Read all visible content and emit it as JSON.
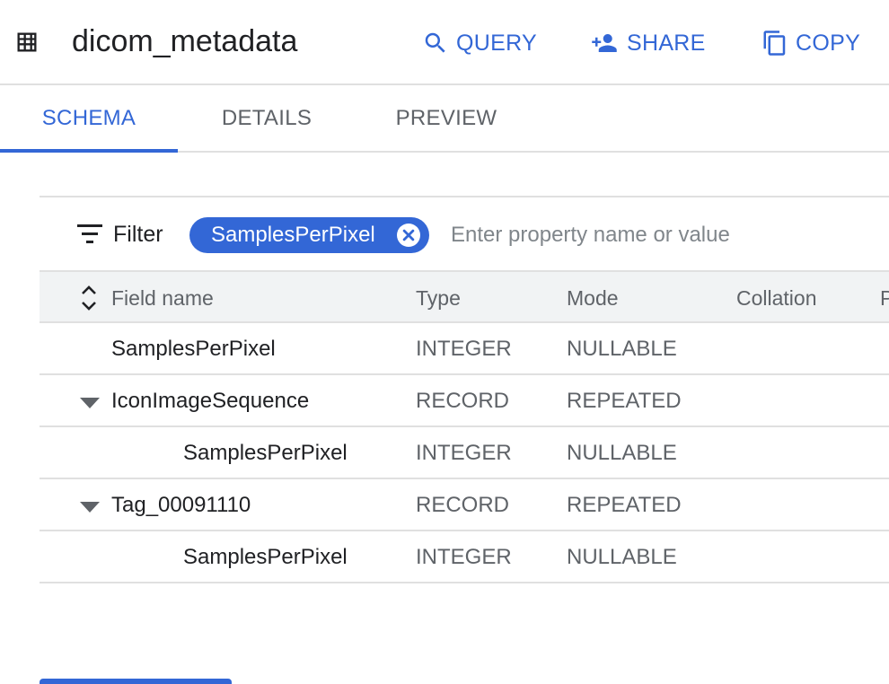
{
  "header": {
    "title": "dicom_metadata",
    "icon": "table-icon",
    "actions": [
      {
        "label": "QUERY",
        "icon": "search-icon"
      },
      {
        "label": "SHARE",
        "icon": "person-add-icon"
      },
      {
        "label": "COPY",
        "icon": "copy-icon"
      }
    ]
  },
  "tabs": [
    {
      "label": "SCHEMA",
      "active": true
    },
    {
      "label": "DETAILS",
      "active": false
    },
    {
      "label": "PREVIEW",
      "active": false
    }
  ],
  "filter": {
    "label": "Filter",
    "chip": "SamplesPerPixel",
    "placeholder": "Enter property name or value",
    "value": ""
  },
  "schema": {
    "columns": [
      "Field name",
      "Type",
      "Mode",
      "Collation",
      "P"
    ],
    "rows": [
      {
        "name": "SamplesPerPixel",
        "type": "INTEGER",
        "mode": "NULLABLE",
        "level": 0,
        "expandable": false
      },
      {
        "name": "IconImageSequence",
        "type": "RECORD",
        "mode": "REPEATED",
        "level": 0,
        "expandable": true
      },
      {
        "name": "SamplesPerPixel",
        "type": "INTEGER",
        "mode": "NULLABLE",
        "level": 1,
        "expandable": false
      },
      {
        "name": "Tag_00091110",
        "type": "RECORD",
        "mode": "REPEATED",
        "level": 0,
        "expandable": true
      },
      {
        "name": "SamplesPerPixel",
        "type": "INTEGER",
        "mode": "NULLABLE",
        "level": 1,
        "expandable": false
      }
    ]
  },
  "colors": {
    "accent": "#3367d6",
    "text": "#202124",
    "muted": "#5f6368",
    "divider": "#e0e0e0",
    "header_bg": "#f1f3f4"
  }
}
